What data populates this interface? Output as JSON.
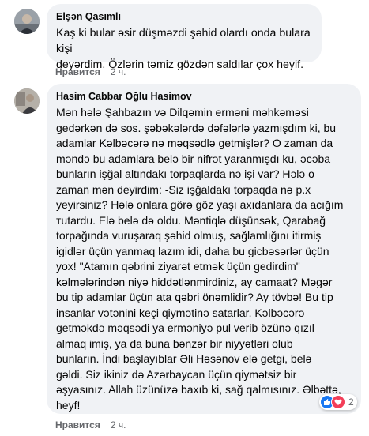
{
  "comments": [
    {
      "author": "Elşən Qasımlı",
      "text": "Kaş ki bular əsir düşməzdi şəhid olardı onda bulara kişi\ndeyərdim. Özlərin təmiz gözdən saldılar çox heyif.",
      "like_label": "Нравится",
      "time": "2 ч."
    },
    {
      "author": "Hasim Cabbar Oğlu Hasimov",
      "text": "Mən hələ Şahbazın və Dilqəmin erməni məhkəməsi\ngedərkən də sos. şəbəkələrdə dəfələrlə yazmışdım ki, bu\nadamlar Kəlbəcərə nə məqsədlə getmişlər? O zaman da\nməndə bu adamlara belə bir nifrət yaranmışdı ku, əcəba\nbunların işğal altındakı torpaqlarda nə işi var? Hələ o\nzaman mən deyirdim: -Siz işğaldakı torpaqda nə p.x\nyeyirsiniz? Hələ onlara görə göz yaşı axıdanlara da acığım\nтutardu. Elə belə də oldu. Məntiqlə düşünsək, Qarabağ\ntorpağında vuruşaraq şəhid olmuş, sağlamlığını itirmiş\nigidlər üçün yanmaq lazım idi, daha bu gicbəsərlər üçün\nyox! \"Atamın qəbrini ziyarət etmək üçün gedirdim\"\nkəlmələrindən niyə hiddətlənmirdiniz, ay camaat? Məgər\nbu tip adamlar üçün ata qəbri önəmlidir? Ay tövbə! Bu tip\ninsanlar vətənini keçi qiymətinə satarlar. Kəlbəcərə\ngetməkdə məqsədi ya erməniyə pul verib özünə qızıl\nalmaq imiş, ya da buna bənzər bir niyyətləri olub\nbunların. İndi başlayıblar Əli Həsənov elə getgi, belə\ngəldi. Siz ikiniz də Azərbaycan üçün qiymətsiz bir\nəşyasınız. Allah üzünüzə baxıb ki, sağ qalmısınız. Əlbəttə,\nheyf!",
      "like_label": "Нравится",
      "time": "2 ч.",
      "reaction_count": "2"
    }
  ],
  "icons": {
    "like_react": "thumbs-up-icon",
    "love_react": "heart-icon"
  },
  "colors": {
    "bubble": "#f0f2f5",
    "meta": "#65676b",
    "like_blue": "#1877f2",
    "love_red": "#f33e58"
  }
}
